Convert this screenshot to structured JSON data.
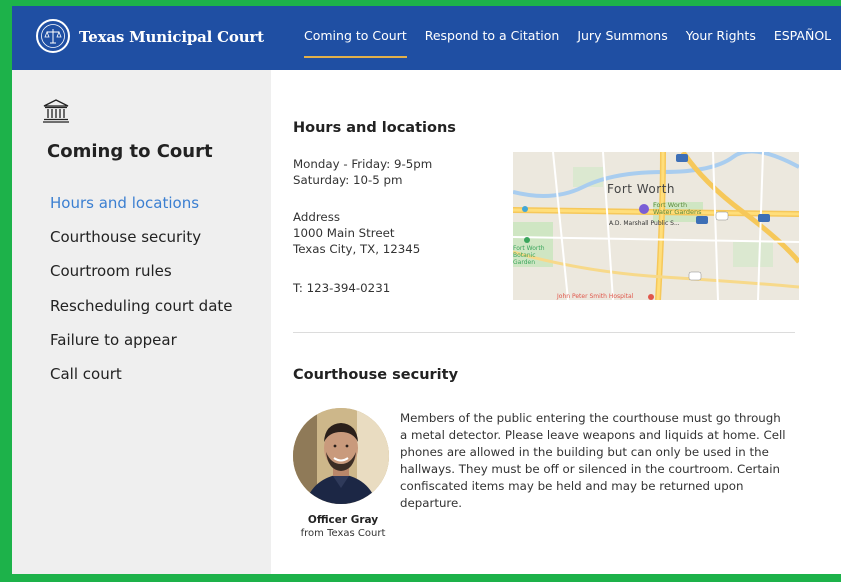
{
  "header": {
    "brand": "Texas Municipal Court",
    "logo_icon": "scales-of-justice-seal-icon",
    "nav": [
      {
        "label": "Coming to Court",
        "active": true
      },
      {
        "label": "Respond to a Citation",
        "active": false
      },
      {
        "label": "Jury Summons",
        "active": false
      },
      {
        "label": "Your Rights",
        "active": false
      },
      {
        "label": "ESPAÑOL",
        "active": false
      }
    ],
    "bg_color": "#1f4fa3",
    "active_underline_color": "#e2b04a"
  },
  "sidebar": {
    "icon": "courthouse-icon",
    "title": "Coming to Court",
    "items": [
      {
        "label": "Hours and locations",
        "active": true
      },
      {
        "label": "Courthouse security",
        "active": false
      },
      {
        "label": "Courtroom rules",
        "active": false
      },
      {
        "label": "Rescheduling court date",
        "active": false
      },
      {
        "label": "Failure to appear",
        "active": false
      },
      {
        "label": "Call court",
        "active": false
      }
    ],
    "active_color": "#3b7fd1"
  },
  "hours": {
    "heading": "Hours and locations",
    "weekday": "Monday - Friday: 9-5pm",
    "saturday": "Saturday: 10-5 pm",
    "address_label": "Address",
    "street": "1000 Main Street",
    "city": "Texas City, TX, 12345",
    "phone": "T: 123-394-0231",
    "map": {
      "city_label": "Fort Worth",
      "gardens_label": "Fort Worth Water Gardens",
      "marshall_label": "A.D. Marshall Public S...",
      "botanic_label": "Fort Worth Botanic Garden",
      "hospital_label": "John Peter Smith Hospital"
    }
  },
  "security": {
    "heading": "Courthouse security",
    "body": "Members of the public entering the courthouse must go through a metal detector. Please leave weapons and liquids at home. Cell phones are allowed in the building but can only be used in the hallways. They must be off or silenced in the courtroom. Certain confiscated items may be held and may be returned upon departure.",
    "officer_name": "Officer Gray",
    "officer_org": "from Texas Court"
  },
  "frame_color": "#1db24a"
}
